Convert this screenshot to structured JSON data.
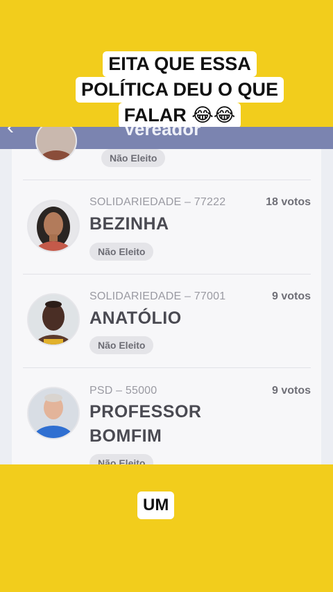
{
  "caption_top": {
    "line1": "EITA QUE ESSA",
    "line2": "POLÍTICA DEU O QUE",
    "line3": "FALAR 😂😂"
  },
  "app": {
    "header_title": "Vereador",
    "back_icon": "chevron-left-icon"
  },
  "candidates": [
    {
      "party": "",
      "name": "",
      "votes": "",
      "status": "Não Eleito"
    },
    {
      "party": "SOLIDARIEDADE – 77222",
      "name": "BEZINHA",
      "votes": "18 votos",
      "status": "Não Eleito"
    },
    {
      "party": "SOLIDARIEDADE – 77001",
      "name": "ANATÓLIO",
      "votes": "9 votos",
      "status": "Não Eleito"
    },
    {
      "party": "PSD – 55000",
      "name_line1": "PROFESSOR",
      "name_line2": "BOMFIM",
      "votes": "9 votos",
      "status": "Não Eleito"
    }
  ],
  "caption_bottom": "UM",
  "colors": {
    "background": "#f2cd1c",
    "header": "#7b84b0",
    "badge": "#e4e4e8"
  }
}
